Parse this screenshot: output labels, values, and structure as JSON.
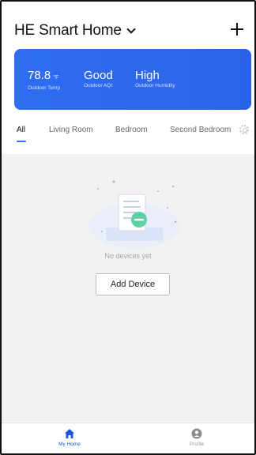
{
  "header": {
    "title": "HE Smart Home"
  },
  "weather": {
    "temp": {
      "value": "78.8",
      "unit": "°F",
      "label": "Outdoor Temp"
    },
    "aqi": {
      "value": "Good",
      "label": "Outdoor AQI"
    },
    "humidity": {
      "value": "High",
      "label": "Outdoor Humidity"
    }
  },
  "tabs": [
    {
      "label": "All"
    },
    {
      "label": "Living Room"
    },
    {
      "label": "Bedroom"
    },
    {
      "label": "Second Bedroom"
    }
  ],
  "empty_state": {
    "message": "No devices yet",
    "button_label": "Add Device"
  },
  "bottom_nav": {
    "home_label": "My Home",
    "profile_label": "Profile"
  },
  "colors": {
    "accent": "#2f6df2",
    "card": "#2a63ea",
    "illustration_green": "#5ed2a5"
  }
}
